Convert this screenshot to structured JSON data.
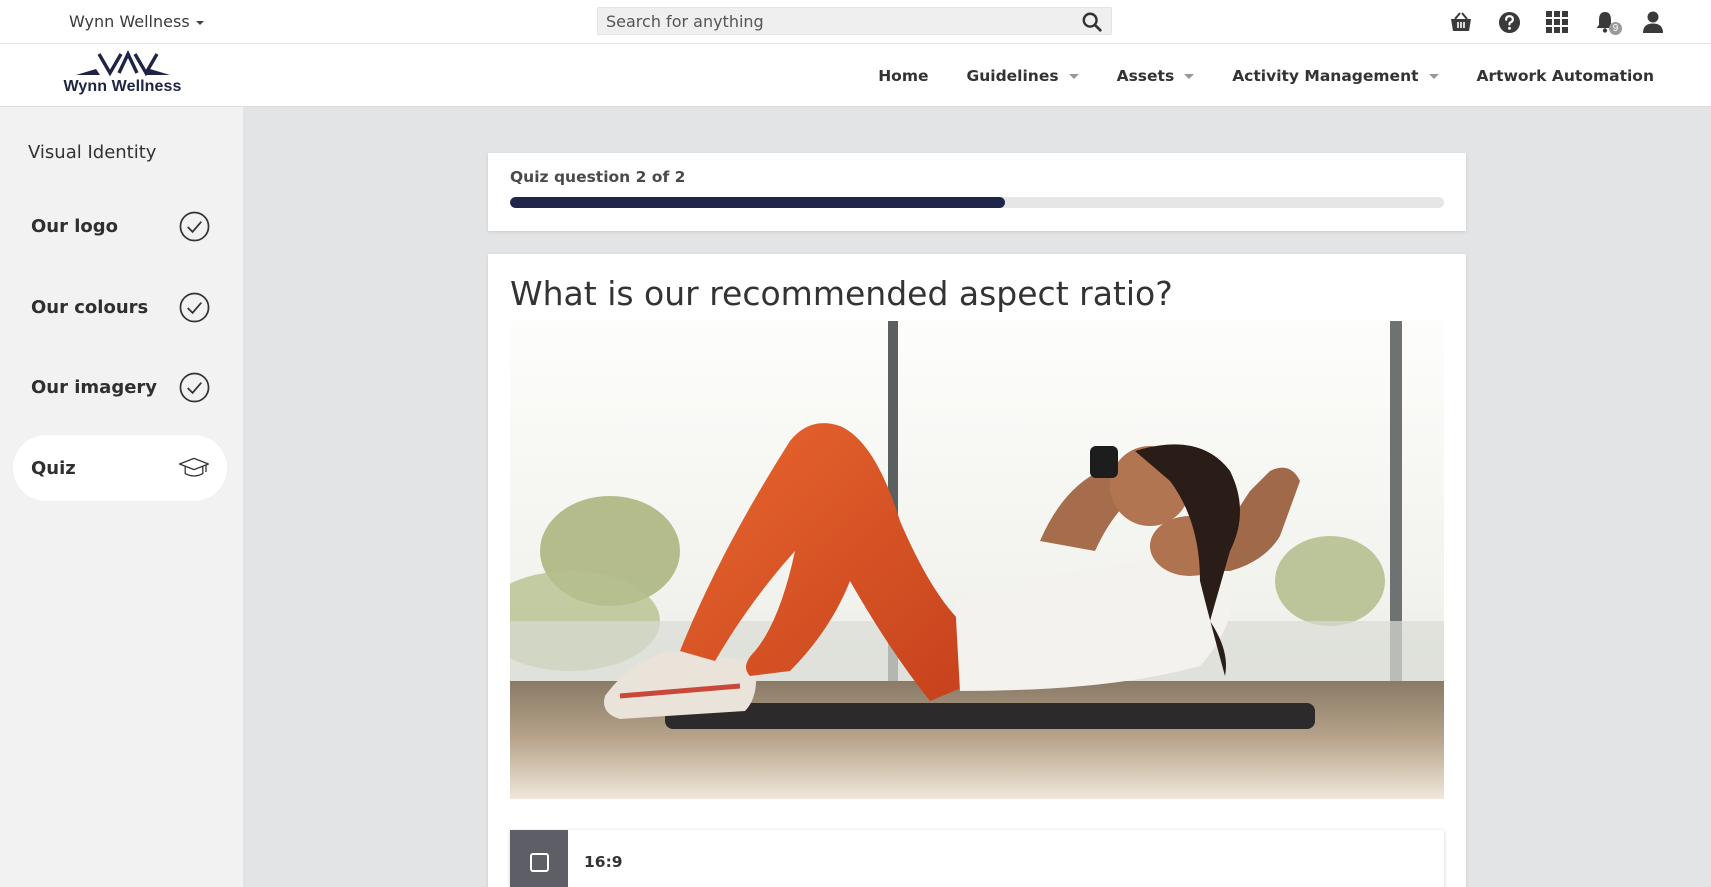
{
  "topbar": {
    "brand_switch": "Wynn Wellness",
    "search_placeholder": "Search for anything",
    "notifications_count": "9"
  },
  "logo": {
    "text": "Wynn Wellness"
  },
  "nav": {
    "items": [
      {
        "label": "Home"
      },
      {
        "label": "Guidelines"
      },
      {
        "label": "Assets"
      },
      {
        "label": "Activity Management"
      },
      {
        "label": "Artwork Automation"
      }
    ]
  },
  "sidebar": {
    "heading": "Visual Identity",
    "items": [
      {
        "label": "Our logo",
        "icon": "check-circle-icon",
        "completed": true
      },
      {
        "label": "Our colours",
        "icon": "check-circle-icon",
        "completed": true
      },
      {
        "label": "Our imagery",
        "icon": "check-circle-icon",
        "completed": true
      },
      {
        "label": "Quiz",
        "icon": "graduation-cap-icon",
        "active": true
      }
    ]
  },
  "quiz": {
    "progress_label": "Quiz question 2 of 2",
    "progress_fraction": 0.53,
    "question": "What is our recommended aspect ratio?",
    "image_desc_icon": "photo-woman-doing-crunches",
    "answers": [
      {
        "label": "16:9"
      }
    ]
  },
  "colors": {
    "brand_navy": "#20264a",
    "sidebar_bg": "#f2f2f2",
    "page_bg": "#e3e4e6",
    "checkbox_bg": "#5e5f66"
  }
}
